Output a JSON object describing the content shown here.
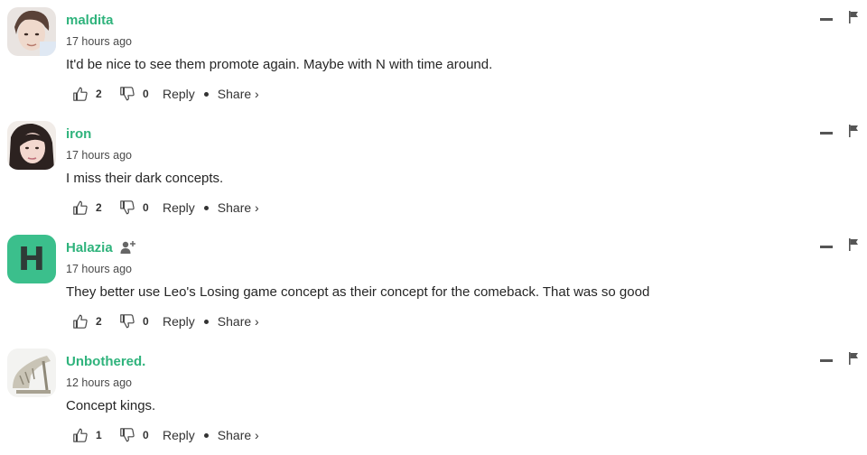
{
  "comments": [
    {
      "username": "maldita",
      "time": "17 hours ago",
      "text": "It'd be nice to see them promote again. Maybe with N with time around.",
      "likes": "2",
      "dislikes": "0",
      "avatar_type": "photo"
    },
    {
      "username": "iron",
      "time": "17 hours ago",
      "text": "I miss their dark concepts.",
      "likes": "2",
      "dislikes": "0",
      "avatar_type": "photo"
    },
    {
      "username": "Halazia",
      "time": "17 hours ago",
      "text": "They better use Leo's Losing game concept as their concept for the comeback. That was so good",
      "likes": "2",
      "dislikes": "0",
      "avatar_type": "letter",
      "avatar_letter": "H",
      "follow_icon": "add-user-icon"
    },
    {
      "username": "Unbothered.",
      "time": "12 hours ago",
      "text": "Concept kings.",
      "likes": "1",
      "dislikes": "0",
      "avatar_type": "photo"
    }
  ],
  "actions": {
    "reply_label": "Reply",
    "share_label": "Share ›"
  },
  "colors": {
    "username": "#2fb37c",
    "avatar_bg": "#3bbf8c"
  }
}
